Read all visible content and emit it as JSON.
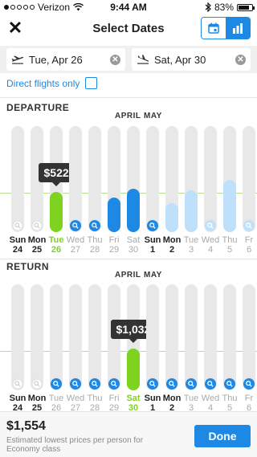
{
  "status_bar": {
    "carrier": "Verizon",
    "time": "9:44 AM",
    "battery": "83%",
    "battery_level": 0.83
  },
  "nav": {
    "title": "Select Dates"
  },
  "dates": {
    "depart_value": "Tue, Apr 26",
    "return_value": "Sat, Apr 30"
  },
  "direct": {
    "label": "Direct flights only"
  },
  "departure": {
    "title": "DEPARTURE",
    "month_april": "APRIL",
    "month_may": "MAY",
    "selected_price": "$522",
    "days": [
      {
        "name": "Sun",
        "date": "24",
        "level": 0,
        "state": "empty",
        "active": true
      },
      {
        "name": "Mon",
        "date": "25",
        "level": 0,
        "state": "empty",
        "active": true
      },
      {
        "name": "Tue",
        "date": "26",
        "level": 0.55,
        "state": "selected",
        "active": true
      },
      {
        "name": "Wed",
        "date": "27",
        "level": 0,
        "state": "search",
        "active": false
      },
      {
        "name": "Thu",
        "date": "28",
        "level": 0,
        "state": "search",
        "active": false
      },
      {
        "name": "Fri",
        "date": "29",
        "level": 0.48,
        "state": "price",
        "active": false
      },
      {
        "name": "Sat",
        "date": "30",
        "level": 0.6,
        "state": "price",
        "active": false
      },
      {
        "name": "Sun",
        "date": "1",
        "level": 0,
        "state": "search",
        "active": true
      },
      {
        "name": "Mon",
        "date": "2",
        "level": 0.4,
        "state": "light",
        "active": true
      },
      {
        "name": "Tue",
        "date": "3",
        "level": 0.58,
        "state": "light",
        "active": false
      },
      {
        "name": "Wed",
        "date": "4",
        "level": 0,
        "state": "lightsearch",
        "active": false
      },
      {
        "name": "Thu",
        "date": "5",
        "level": 0.72,
        "state": "light",
        "active": false
      },
      {
        "name": "Fr",
        "date": "6",
        "level": 0,
        "state": "lightsearch",
        "active": false
      }
    ]
  },
  "return": {
    "title": "RETURN",
    "month_april": "APRIL",
    "month_may": "MAY",
    "selected_price": "$1,032",
    "days": [
      {
        "name": "Sun",
        "date": "24",
        "level": 0,
        "state": "empty",
        "active": true
      },
      {
        "name": "Mon",
        "date": "25",
        "level": 0,
        "state": "empty",
        "active": true
      },
      {
        "name": "Tue",
        "date": "26",
        "level": 0,
        "state": "search",
        "active": false
      },
      {
        "name": "Wed",
        "date": "27",
        "level": 0,
        "state": "search",
        "active": false
      },
      {
        "name": "Thu",
        "date": "28",
        "level": 0,
        "state": "search",
        "active": false
      },
      {
        "name": "Fri",
        "date": "29",
        "level": 0,
        "state": "search",
        "active": false
      },
      {
        "name": "Sat",
        "date": "30",
        "level": 0.58,
        "state": "selected",
        "active": true
      },
      {
        "name": "Sun",
        "date": "1",
        "level": 0,
        "state": "search",
        "active": true
      },
      {
        "name": "Mon",
        "date": "2",
        "level": 0,
        "state": "search",
        "active": true
      },
      {
        "name": "Tue",
        "date": "3",
        "level": 0,
        "state": "search",
        "active": false
      },
      {
        "name": "Wed",
        "date": "4",
        "level": 0,
        "state": "search",
        "active": false
      },
      {
        "name": "Thu",
        "date": "5",
        "level": 0,
        "state": "search",
        "active": false
      },
      {
        "name": "Fr",
        "date": "6",
        "level": 0,
        "state": "search",
        "active": false
      }
    ]
  },
  "footer": {
    "price": "$1,554",
    "note": "Estimated lowest prices per person for Economy class",
    "done_label": "Done"
  },
  "colors": {
    "accent": "#1e88e5",
    "selected": "#7ed321",
    "price_bar": "#1e88e5",
    "light_bar": "#bfe0fb",
    "track": "#e8e8e8"
  },
  "icons": {
    "close": "close-icon",
    "calendar": "calendar-icon",
    "bar_chart": "bar-chart-icon",
    "depart_plane": "plane-depart-icon",
    "return_plane": "plane-return-icon",
    "clear": "clear-icon",
    "search": "search-icon"
  }
}
